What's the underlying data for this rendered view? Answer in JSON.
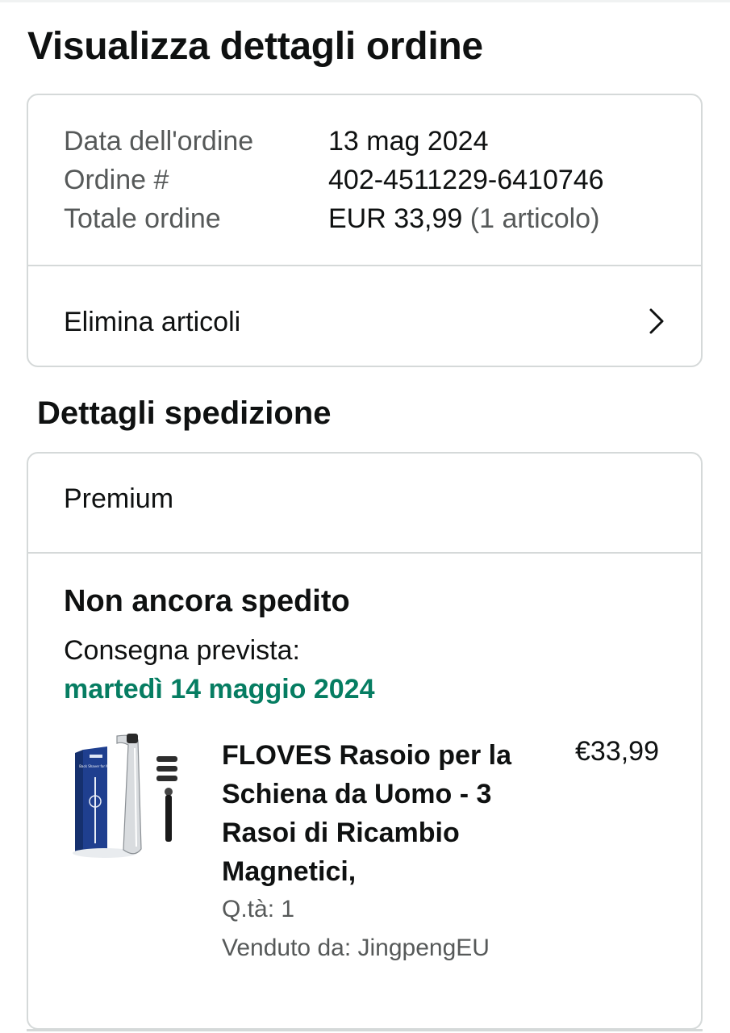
{
  "page": {
    "title": "Visualizza dettagli ordine"
  },
  "order_summary": {
    "date_label": "Data dell'ordine",
    "date_value": "13 mag 2024",
    "number_label": "Ordine #",
    "number_value": "402-4511229-6410746",
    "total_label": "Totale ordine",
    "total_value": "EUR 33,99",
    "total_items": "(1 articolo)",
    "remove_items_label": "Elimina articoli",
    "remove_items_icon": "chevron-right-icon"
  },
  "shipping": {
    "section_title": "Dettagli spedizione",
    "method": "Premium",
    "status": "Non ancora spedito",
    "eta_label": "Consegna prevista:",
    "eta_date": "martedì 14 maggio 2024",
    "eta_color": "#067d62",
    "item": {
      "title": "FLOVES Rasoio per la Schiena da Uomo - 3 Rasoi di Ricambio Magnetici,",
      "price": "€33,99",
      "quantity": "Q.tà: 1",
      "seller": "Venduto da: JingpengEU",
      "image_icon": "back-shaver-product-image",
      "package_text": "Back Shaver for Men"
    }
  }
}
